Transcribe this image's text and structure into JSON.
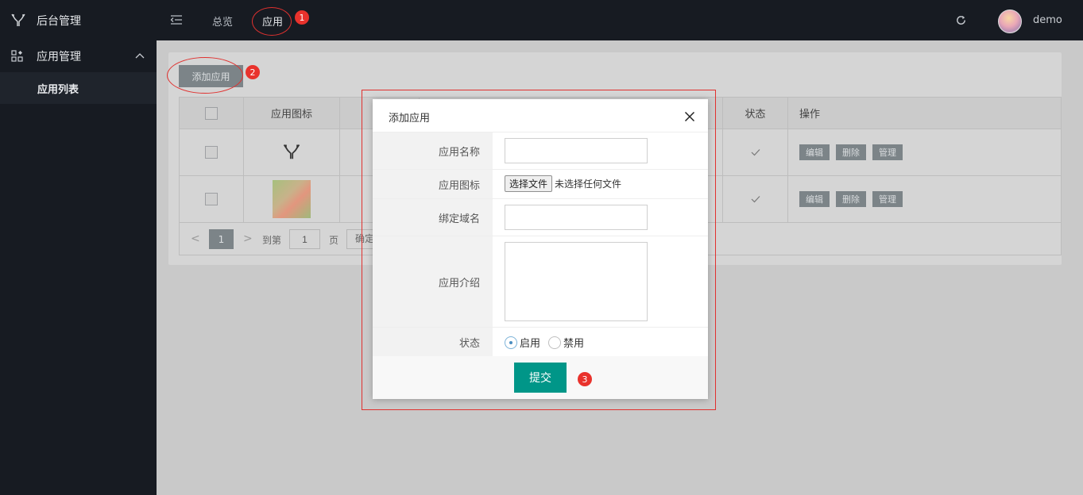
{
  "brand": {
    "title": "后台管理"
  },
  "sidebar": {
    "parent_label": "应用管理",
    "child_label": "应用列表"
  },
  "topbar": {
    "nav": [
      {
        "label": "总览"
      },
      {
        "label": "应用"
      }
    ],
    "user_name": "demo"
  },
  "toolbar": {
    "add_label": "添加应用"
  },
  "table": {
    "headers": {
      "icon": "应用图标",
      "status": "状态",
      "ops": "操作"
    },
    "row_actions": [
      "编辑",
      "删除",
      "管理"
    ]
  },
  "pager": {
    "prev": "<",
    "current": "1",
    "next": ">",
    "goto_label": "到第",
    "goto_value": "1",
    "page_label": "页",
    "confirm_label": "确定"
  },
  "annotations": [
    "1",
    "2",
    "3"
  ],
  "modal": {
    "title": "添加应用",
    "fields": {
      "name_label": "应用名称",
      "icon_label": "应用图标",
      "file_button": "选择文件",
      "file_status": "未选择任何文件",
      "domain_label": "绑定域名",
      "intro_label": "应用介绍",
      "status_label": "状态",
      "status_enabled": "启用",
      "status_disabled": "禁用"
    },
    "submit_label": "提交"
  },
  "colors": {
    "sidebar_bg": "#171b22",
    "submit_green": "#009688",
    "annotation_red": "#e9322c"
  }
}
